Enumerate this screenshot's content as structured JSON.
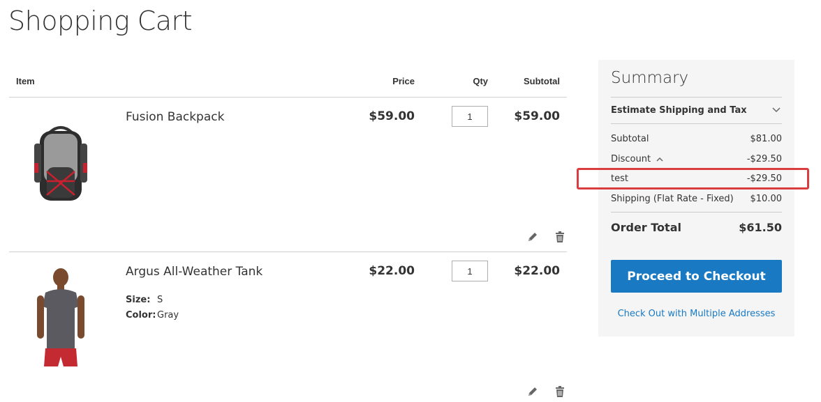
{
  "page": {
    "title": "Shopping Cart"
  },
  "cart": {
    "headers": {
      "item": "Item",
      "price": "Price",
      "qty": "Qty",
      "subtotal": "Subtotal"
    },
    "items": [
      {
        "name": "Fusion Backpack",
        "price": "$59.00",
        "qty": "1",
        "subtotal": "$59.00",
        "image_icon": "backpack-product-image",
        "options": []
      },
      {
        "name": "Argus All-Weather Tank",
        "price": "$22.00",
        "qty": "1",
        "subtotal": "$22.00",
        "image_icon": "tank-top-model-product-image",
        "options": [
          {
            "label": "Size:",
            "value": "S"
          },
          {
            "label": "Color:",
            "value": "Gray"
          }
        ]
      }
    ],
    "action_icons": [
      "pencil-edit-icon",
      "trash-delete-icon"
    ]
  },
  "summary": {
    "title": "Summary",
    "estimate_label": "Estimate Shipping and Tax",
    "rows": {
      "subtotal": {
        "label": "Subtotal",
        "value": "$81.00"
      },
      "discount": {
        "label": "Discount",
        "value": "-$29.50"
      },
      "discount_detail": {
        "label": "test",
        "value": "-$29.50"
      },
      "shipping": {
        "label": "Shipping (Flat Rate - Fixed)",
        "value": "$10.00"
      }
    },
    "order_total": {
      "label": "Order Total",
      "value": "$61.50"
    },
    "checkout_button": "Proceed to Checkout",
    "multi_address_link": "Check Out with Multiple Addresses"
  },
  "colors": {
    "accent_blue": "#1979c3",
    "summary_bg": "#f5f5f5",
    "highlight_red": "#d93d3f",
    "text": "#333333"
  }
}
